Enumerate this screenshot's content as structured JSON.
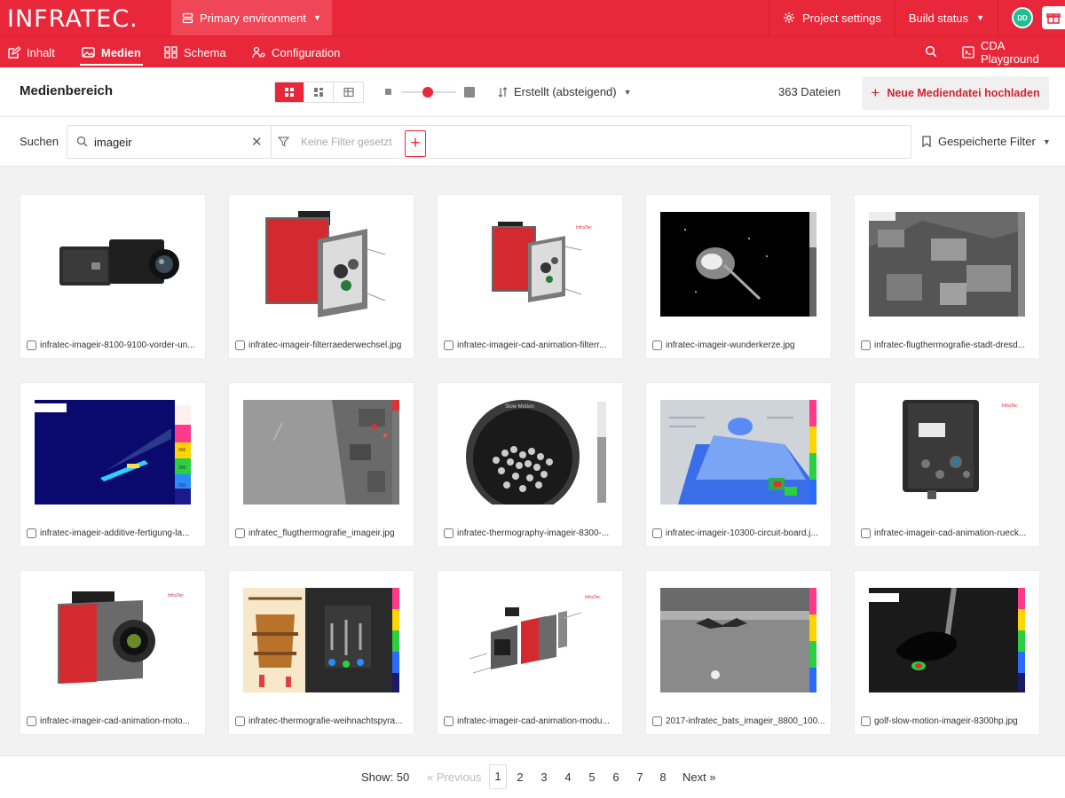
{
  "header": {
    "logo_text": "INFRATEC.",
    "environment": "Primary environment",
    "project_settings": "Project settings",
    "build_status": "Build status",
    "avatar_initials": "DD"
  },
  "nav": {
    "items": [
      {
        "label": "Inhalt",
        "icon": "edit-icon"
      },
      {
        "label": "Medien",
        "icon": "image-icon",
        "active": true
      },
      {
        "label": "Schema",
        "icon": "schema-icon"
      },
      {
        "label": "Configuration",
        "icon": "configuration-icon"
      }
    ],
    "playground": "CDA Playground"
  },
  "toolbar": {
    "title": "Medienbereich",
    "sort_label": "Erstellt (absteigend)",
    "file_count": "363 Dateien",
    "upload_label": "Neue Mediendatei hochladen"
  },
  "search": {
    "label": "Suchen",
    "query": "imageir",
    "filter_placeholder": "Keine Filter gesetzt",
    "saved_filters": "Gespeicherte Filter"
  },
  "media": [
    {
      "name": "infratec-imageir-8100-9100-vorder-un...",
      "thumb": "cameras-product"
    },
    {
      "name": "infratec-imageir-filterraederwechsel.jpg",
      "thumb": "camera-open-filter"
    },
    {
      "name": "infratec-imageir-cad-animation-filterr...",
      "thumb": "camera-cad"
    },
    {
      "name": "infratec-imageir-wunderkerze.jpg",
      "thumb": "thermal-sparkler"
    },
    {
      "name": "infratec-flugthermografie-stadt-dresd...",
      "thumb": "thermal-city"
    },
    {
      "name": "infratec-imageir-additive-fertigung-la...",
      "thumb": "thermal-additive"
    },
    {
      "name": "infratec_flugthermografie_imageir.jpg",
      "thumb": "thermal-aerial"
    },
    {
      "name": "infratec-thermography-imageir-8300-...",
      "thumb": "thermal-slowmotion"
    },
    {
      "name": "infratec-imageir-10300-circuit-board.j...",
      "thumb": "thermal-circuit"
    },
    {
      "name": "infratec-imageir-cad-animation-rueck...",
      "thumb": "camera-back"
    },
    {
      "name": "infratec-imageir-cad-animation-moto...",
      "thumb": "camera-red"
    },
    {
      "name": "infratec-thermografie-weihnachtspyra...",
      "thumb": "thermal-pyramid"
    },
    {
      "name": "infratec-imageir-cad-animation-modu...",
      "thumb": "camera-exploded"
    },
    {
      "name": "2017-infratec_bats_imageir_8800_100...",
      "thumb": "thermal-bats"
    },
    {
      "name": "golf-slow-motion-imageir-8300hp.jpg",
      "thumb": "thermal-golf"
    }
  ],
  "slow_motion_label": "Slow Motion",
  "scale_labels": [
    "400",
    "300",
    "200"
  ],
  "pagination": {
    "show": "Show: 50",
    "previous": "« Previous",
    "pages": [
      "1",
      "2",
      "3",
      "4",
      "5",
      "6",
      "7",
      "8"
    ],
    "current": "1",
    "next": "Next »"
  },
  "colors": {
    "brand": "#e8283a",
    "env_bg": "#ef4757",
    "avatar": "#1fbf8f"
  }
}
